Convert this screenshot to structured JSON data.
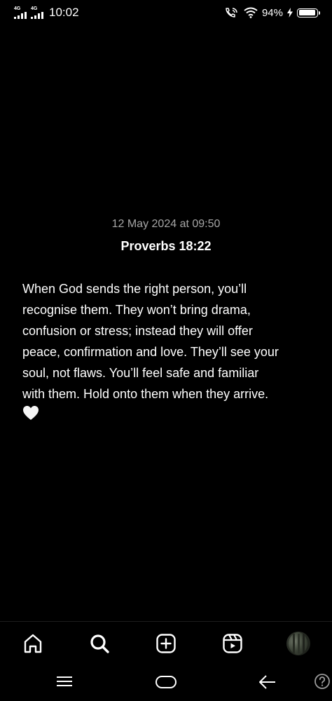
{
  "status_bar": {
    "network_1": "4G",
    "network_2": "4G",
    "time": "10:02",
    "battery_percent": "94%",
    "battery_level": 0.94
  },
  "post": {
    "date": "12 May 2024 at 09:50",
    "reference": "Proverbs 18:22",
    "text": "When God sends the right person, you’ll\nrecognise them. They won’t bring drama,\nconfusion or stress; instead they will offer\npeace, confirmation and love. They’ll see your\nsoul, not flaws. You’ll feel safe and familiar\nwith them. Hold onto them when they arrive.",
    "emoji": "white-heart-icon"
  },
  "bottom_nav": {
    "items": [
      "home-icon",
      "search-icon",
      "create-post-icon",
      "reels-icon",
      "profile-avatar"
    ]
  },
  "system_nav": {
    "items": [
      "menu-icon",
      "home-pill-icon",
      "back-arrow-icon",
      "help-icon"
    ]
  }
}
